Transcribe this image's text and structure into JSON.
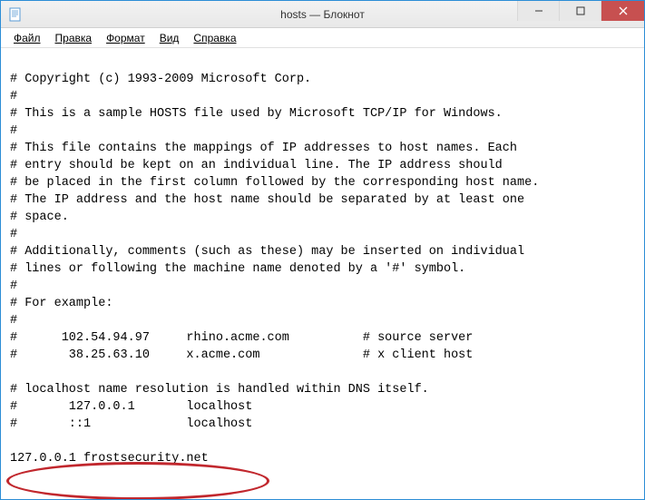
{
  "window": {
    "title": "hosts — Блокнот"
  },
  "menu": {
    "file": "Файл",
    "edit": "Правка",
    "format": "Формат",
    "view": "Вид",
    "help": "Справка"
  },
  "content": {
    "l1": "# Copyright (c) 1993-2009 Microsoft Corp.",
    "l2": "#",
    "l3": "# This is a sample HOSTS file used by Microsoft TCP/IP for Windows.",
    "l4": "#",
    "l5": "# This file contains the mappings of IP addresses to host names. Each",
    "l6": "# entry should be kept on an individual line. The IP address should",
    "l7": "# be placed in the first column followed by the corresponding host name.",
    "l8": "# The IP address and the host name should be separated by at least one",
    "l9": "# space.",
    "l10": "#",
    "l11": "# Additionally, comments (such as these) may be inserted on individual",
    "l12": "# lines or following the machine name denoted by a '#' symbol.",
    "l13": "#",
    "l14": "# For example:",
    "l15": "#",
    "l16": "#      102.54.94.97     rhino.acme.com          # source server",
    "l17": "#       38.25.63.10     x.acme.com              # x client host",
    "l18": "",
    "l19": "# localhost name resolution is handled within DNS itself.",
    "l20": "#       127.0.0.1       localhost",
    "l21": "#       ::1             localhost",
    "l22": "",
    "l23": "127.0.0.1 frostsecurity.net"
  }
}
